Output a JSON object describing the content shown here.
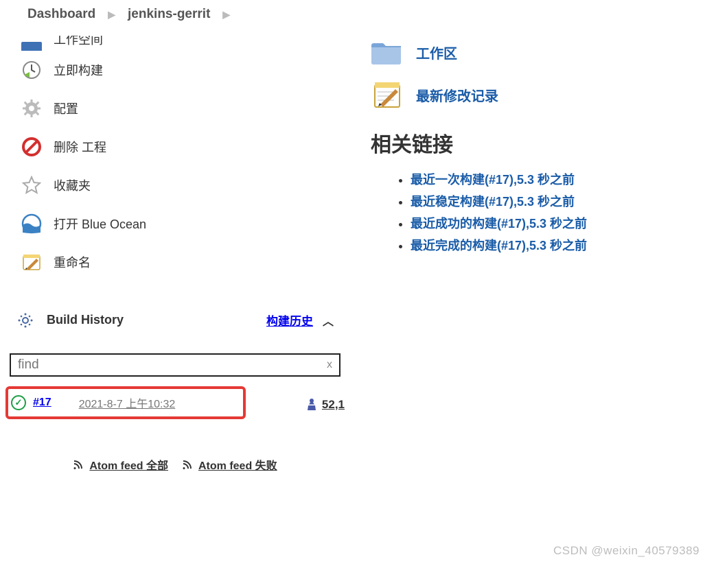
{
  "breadcrumb": {
    "home": "Dashboard",
    "project": "jenkins-gerrit"
  },
  "sidebar": {
    "items": [
      {
        "label": "工作空间",
        "icon": "terminal-icon",
        "partial": true
      },
      {
        "label": "立即构建",
        "icon": "clock-play-icon"
      },
      {
        "label": "配置",
        "icon": "gear-icon"
      },
      {
        "label": "删除 工程",
        "icon": "delete-icon"
      },
      {
        "label": "收藏夹",
        "icon": "star-icon"
      },
      {
        "label": "打开 Blue Ocean",
        "icon": "blueocean-icon"
      },
      {
        "label": "重命名",
        "icon": "notepad-icon"
      }
    ]
  },
  "history": {
    "title": "Build History",
    "trend_label": "构建历史",
    "find_placeholder": "find",
    "builds": [
      {
        "status": "success",
        "number": "#17",
        "date": "2021-8-7 上午10:32",
        "highlight": true,
        "score": "52,1"
      }
    ],
    "feeds": {
      "all": "Atom feed 全部",
      "failed": "Atom feed 失败"
    }
  },
  "main": {
    "workspace": "工作区",
    "changes": "最新修改记录",
    "related_title": "相关链接",
    "related": [
      "最近一次构建(#17),5.3 秒之前",
      "最近稳定构建(#17),5.3 秒之前",
      "最近成功的构建(#17),5.3 秒之前",
      "最近完成的构建(#17),5.3 秒之前"
    ]
  },
  "watermark": "CSDN @weixin_40579389"
}
